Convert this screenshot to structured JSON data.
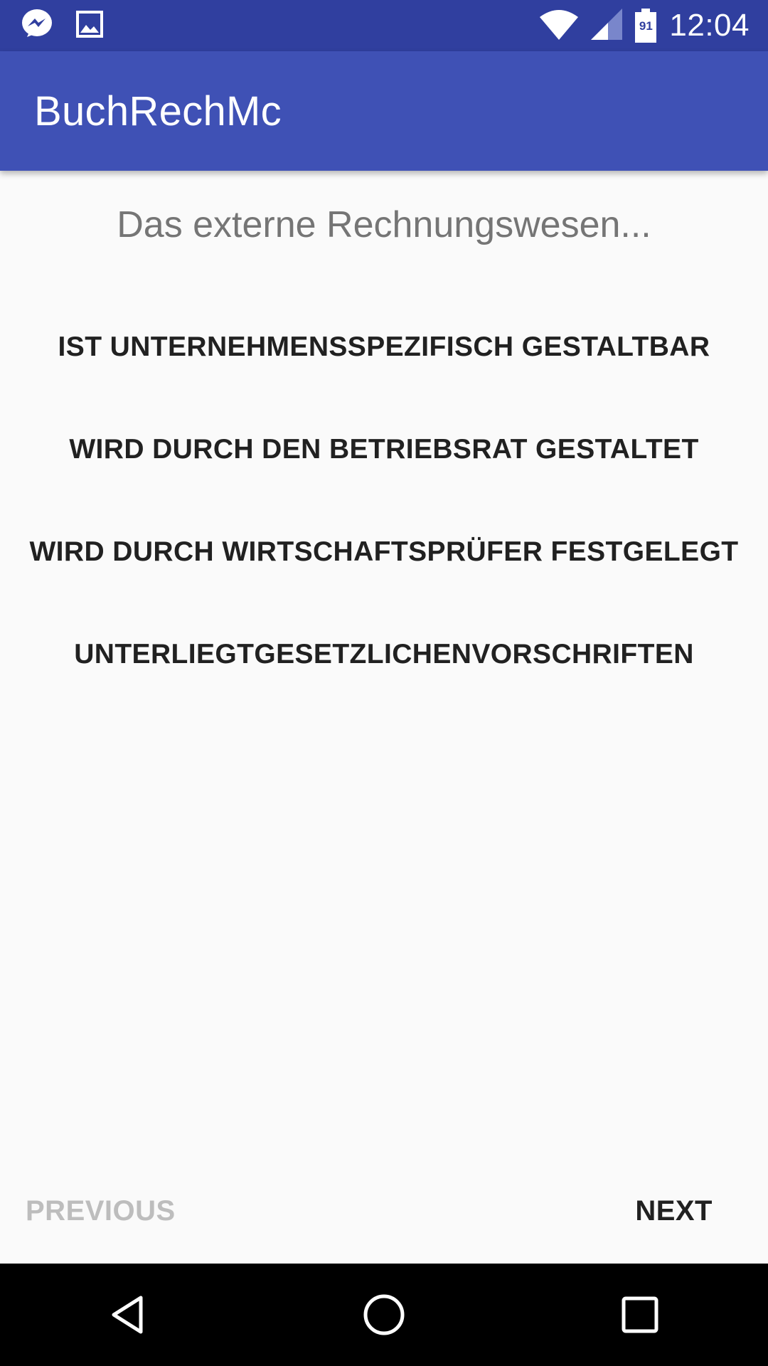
{
  "status_bar": {
    "time": "12:04",
    "battery_level": "91",
    "icons": [
      "messenger-icon",
      "image-icon",
      "wifi-icon",
      "cell-signal-icon",
      "battery-icon"
    ]
  },
  "app_bar": {
    "title": "BuchRechMc"
  },
  "quiz": {
    "question": "Das externe Rechnungswesen...",
    "answers": [
      "IST UNTERNEHMENSSPEZIFISCH GESTALTBAR",
      "WIRD DURCH DEN BETRIEBSRAT GESTALTET",
      "WIRD DURCH WIRTSCHAFTSPRÜFER FESTGELEGT",
      "UNTERLIEGTGESETZLICHENVORSCHRIFTEN"
    ]
  },
  "footer": {
    "previous_label": "PREVIOUS",
    "next_label": "NEXT",
    "previous_enabled": false
  },
  "colors": {
    "status_bar": "#303f9f",
    "app_bar": "#3f51b5",
    "background": "#fafafa",
    "question_text": "#757575",
    "answer_text": "#212121",
    "disabled_text": "#bdbdbd"
  }
}
